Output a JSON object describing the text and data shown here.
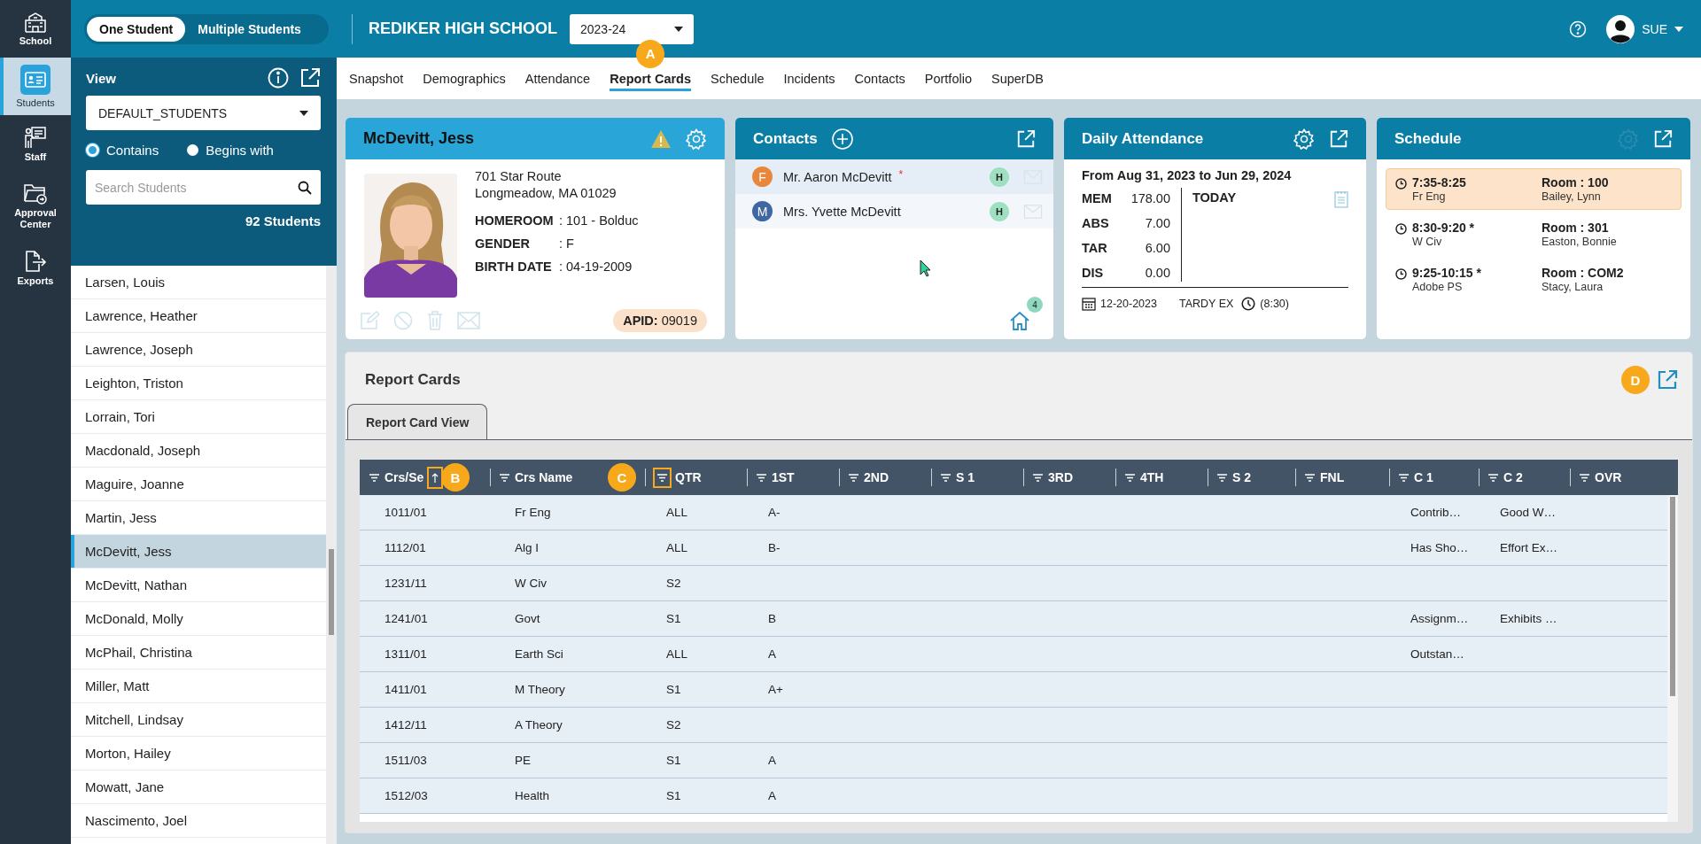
{
  "rail": [
    {
      "label": "School",
      "selected": false
    },
    {
      "label": "Students",
      "selected": true
    },
    {
      "label": "Staff",
      "selected": false
    },
    {
      "label": "Approval Center",
      "selected": false
    },
    {
      "label": "Exports",
      "selected": false
    }
  ],
  "mode_toggle": [
    {
      "label": "One Student",
      "selected": true
    },
    {
      "label": "Multiple Students",
      "selected": false
    }
  ],
  "school": "REDIKER HIGH SCHOOL",
  "year": "2023-24",
  "user": "SUE",
  "tabs": [
    {
      "label": "Snapshot",
      "selected": false
    },
    {
      "label": "Demographics",
      "selected": false
    },
    {
      "label": "Attendance",
      "selected": false
    },
    {
      "label": "Report Cards",
      "selected": true,
      "callout": "A"
    },
    {
      "label": "Schedule",
      "selected": false
    },
    {
      "label": "Incidents",
      "selected": false
    },
    {
      "label": "Contacts",
      "selected": false
    },
    {
      "label": "Portfolio",
      "selected": false
    },
    {
      "label": "SuperDB",
      "selected": false
    }
  ],
  "student_panel": {
    "view_label": "View",
    "view": "DEFAULT_STUDENTS",
    "match": [
      {
        "label": "Contains",
        "selected": true
      },
      {
        "label": "Begins with",
        "selected": false
      }
    ],
    "search_placeholder": "Search Students",
    "count": "92 Students"
  },
  "students": [
    {
      "name": "Larsen, Louis",
      "selected": false
    },
    {
      "name": "Lawrence, Heather",
      "selected": false
    },
    {
      "name": "Lawrence, Joseph",
      "selected": false
    },
    {
      "name": "Leighton, Triston",
      "selected": false
    },
    {
      "name": "Lorrain, Tori",
      "selected": false
    },
    {
      "name": "Macdonald, Joseph",
      "selected": false
    },
    {
      "name": "Maguire, Joanne",
      "selected": false
    },
    {
      "name": "Martin, Jess",
      "selected": false
    },
    {
      "name": "McDevitt, Jess",
      "selected": true
    },
    {
      "name": "McDevitt, Nathan",
      "selected": false
    },
    {
      "name": "McDonald, Molly",
      "selected": false
    },
    {
      "name": "McPhail, Christina",
      "selected": false
    },
    {
      "name": "Miller, Matt",
      "selected": false
    },
    {
      "name": "Mitchell, Lindsay",
      "selected": false
    },
    {
      "name": "Morton, Hailey",
      "selected": false
    },
    {
      "name": "Mowatt, Jane",
      "selected": false
    },
    {
      "name": "Nascimento, Joel",
      "selected": false
    }
  ],
  "student_card": {
    "name": "McDevitt, Jess",
    "address": [
      "701 Star Route",
      "Longmeadow, MA 01029"
    ],
    "fields": [
      {
        "label": "HOMEROOM",
        "value": ": 101 - Bolduc"
      },
      {
        "label": "GENDER",
        "value": ": F"
      },
      {
        "label": "BIRTH DATE",
        "value": ": 04-19-2009"
      }
    ],
    "apid": "**APID:** 09019"
  },
  "contacts": {
    "title": "Contacts",
    "items": [
      {
        "initial": "F",
        "name": "Mr. Aaron McDevitt",
        "flag": "*",
        "color": "#e8873a",
        "badge": "H",
        "selected": true
      },
      {
        "initial": "M",
        "name": "Mrs. Yvette McDevitt",
        "color": "#3f67a3",
        "badge": "H",
        "selected": false
      }
    ],
    "household_count": "4"
  },
  "attendance": {
    "title": "Daily Attendance",
    "range": "From Aug 31, 2023 to Jun 29, 2024",
    "stats": [
      {
        "label": "MEM",
        "value": "178.00"
      },
      {
        "label": "ABS",
        "value": "7.00"
      },
      {
        "label": "TAR",
        "value": "6.00"
      },
      {
        "label": "DIS",
        "value": "0.00"
      }
    ],
    "today_label": "TODAY",
    "date": "12-20-2023",
    "code": "TARDY EX",
    "time": "(8:30)"
  },
  "schedule": {
    "title": "Schedule",
    "periods": [
      {
        "time": "7:35-8:25",
        "course": "Fr Eng",
        "room": "Room : 100",
        "teacher": "Bailey, Lynn",
        "selected": true
      },
      {
        "time": "8:30-9:20 *",
        "course": "W Civ",
        "room": "Room : 301",
        "teacher": "Easton, Bonnie",
        "selected": false
      },
      {
        "time": "9:25-10:15 *",
        "course": "Adobe PS",
        "room": "Room : COM2",
        "teacher": "Stacy, Laura",
        "selected": false
      }
    ]
  },
  "report_cards": {
    "title": "Report Cards",
    "callout": "D",
    "tabs": [
      {
        "label": "Report Card View",
        "selected": true
      }
    ],
    "columns": [
      {
        "label": "Crs/Se",
        "sorted": true,
        "callout": "B"
      },
      {
        "label": "Crs Name",
        "sorted": false
      },
      {
        "label": "QTR",
        "sorted": false,
        "callout": "C"
      },
      {
        "label": "1ST",
        "sorted": false
      },
      {
        "label": "2ND",
        "sorted": false
      },
      {
        "label": "S 1",
        "sorted": false
      },
      {
        "label": "3RD",
        "sorted": false
      },
      {
        "label": "4TH",
        "sorted": false
      },
      {
        "label": "S 2",
        "sorted": false
      },
      {
        "label": "FNL",
        "sorted": false
      },
      {
        "label": "C 1",
        "sorted": false
      },
      {
        "label": "C 2",
        "sorted": false
      },
      {
        "label": "OVR",
        "sorted": false
      }
    ],
    "rows": [
      {
        "crs_sec": "1011/01",
        "crs_name": "Fr Eng",
        "qtr": "ALL",
        "q1": "A-",
        "c1": "Contrib…",
        "c2": "Good W…"
      },
      {
        "crs_sec": "1112/01",
        "crs_name": "Alg I",
        "qtr": "ALL",
        "q1": "B-",
        "c1": "Has Sho…",
        "c2": "Effort Ex…"
      },
      {
        "crs_sec": "1231/11",
        "crs_name": "W Civ",
        "qtr": "S2"
      },
      {
        "crs_sec": "1241/01",
        "crs_name": "Govt",
        "qtr": "S1",
        "q1": "B",
        "c1": "Assignm…",
        "c2": "Exhibits …"
      },
      {
        "crs_sec": "1311/01",
        "crs_name": "Earth Sci",
        "qtr": "ALL",
        "q1": "A",
        "c1": "Outstan…"
      },
      {
        "crs_sec": "1411/01",
        "crs_name": "M Theory",
        "qtr": "S1",
        "q1": "A+"
      },
      {
        "crs_sec": "1412/11",
        "crs_name": "A Theory",
        "qtr": "S2"
      },
      {
        "crs_sec": "1511/03",
        "crs_name": "PE",
        "qtr": "S1",
        "q1": "A"
      },
      {
        "crs_sec": "1512/03",
        "crs_name": "Health",
        "qtr": "S1",
        "q1": "A"
      }
    ]
  }
}
